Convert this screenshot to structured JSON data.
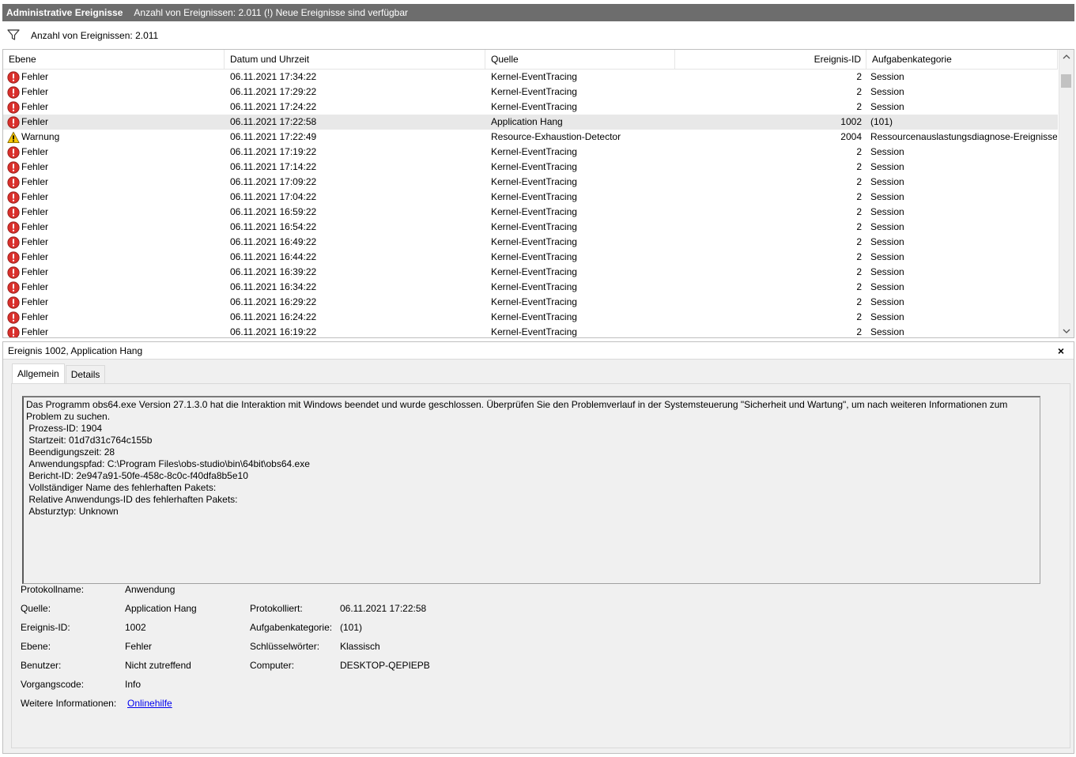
{
  "titlebar": {
    "title": "Administrative Ereignisse",
    "subtitle": "Anzahl von Ereignissen: 2.011 (!) Neue Ereignisse sind verfügbar"
  },
  "filterbar": {
    "icon": "filter-icon",
    "text": "Anzahl von Ereignissen: 2.011"
  },
  "table": {
    "columns": {
      "level": "Ebene",
      "date": "Datum und Uhrzeit",
      "source": "Quelle",
      "id": "Ereignis-ID",
      "category": "Aufgabenkategorie"
    },
    "rows": [
      {
        "level": "Fehler",
        "icon": "error-icon",
        "date": "06.11.2021 17:34:22",
        "source": "Kernel-EventTracing",
        "id": "2",
        "category": "Session"
      },
      {
        "level": "Fehler",
        "icon": "error-icon",
        "date": "06.11.2021 17:29:22",
        "source": "Kernel-EventTracing",
        "id": "2",
        "category": "Session"
      },
      {
        "level": "Fehler",
        "icon": "error-icon",
        "date": "06.11.2021 17:24:22",
        "source": "Kernel-EventTracing",
        "id": "2",
        "category": "Session"
      },
      {
        "level": "Fehler",
        "icon": "error-icon",
        "date": "06.11.2021 17:22:58",
        "source": "Application Hang",
        "id": "1002",
        "category": "(101)",
        "selected": true
      },
      {
        "level": "Warnung",
        "icon": "warning-icon",
        "date": "06.11.2021 17:22:49",
        "source": "Resource-Exhaustion-Detector",
        "id": "2004",
        "category": "Ressourcenauslastungsdiagnose-Ereignisse"
      },
      {
        "level": "Fehler",
        "icon": "error-icon",
        "date": "06.11.2021 17:19:22",
        "source": "Kernel-EventTracing",
        "id": "2",
        "category": "Session"
      },
      {
        "level": "Fehler",
        "icon": "error-icon",
        "date": "06.11.2021 17:14:22",
        "source": "Kernel-EventTracing",
        "id": "2",
        "category": "Session"
      },
      {
        "level": "Fehler",
        "icon": "error-icon",
        "date": "06.11.2021 17:09:22",
        "source": "Kernel-EventTracing",
        "id": "2",
        "category": "Session"
      },
      {
        "level": "Fehler",
        "icon": "error-icon",
        "date": "06.11.2021 17:04:22",
        "source": "Kernel-EventTracing",
        "id": "2",
        "category": "Session"
      },
      {
        "level": "Fehler",
        "icon": "error-icon",
        "date": "06.11.2021 16:59:22",
        "source": "Kernel-EventTracing",
        "id": "2",
        "category": "Session"
      },
      {
        "level": "Fehler",
        "icon": "error-icon",
        "date": "06.11.2021 16:54:22",
        "source": "Kernel-EventTracing",
        "id": "2",
        "category": "Session"
      },
      {
        "level": "Fehler",
        "icon": "error-icon",
        "date": "06.11.2021 16:49:22",
        "source": "Kernel-EventTracing",
        "id": "2",
        "category": "Session"
      },
      {
        "level": "Fehler",
        "icon": "error-icon",
        "date": "06.11.2021 16:44:22",
        "source": "Kernel-EventTracing",
        "id": "2",
        "category": "Session"
      },
      {
        "level": "Fehler",
        "icon": "error-icon",
        "date": "06.11.2021 16:39:22",
        "source": "Kernel-EventTracing",
        "id": "2",
        "category": "Session"
      },
      {
        "level": "Fehler",
        "icon": "error-icon",
        "date": "06.11.2021 16:34:22",
        "source": "Kernel-EventTracing",
        "id": "2",
        "category": "Session"
      },
      {
        "level": "Fehler",
        "icon": "error-icon",
        "date": "06.11.2021 16:29:22",
        "source": "Kernel-EventTracing",
        "id": "2",
        "category": "Session"
      },
      {
        "level": "Fehler",
        "icon": "error-icon",
        "date": "06.11.2021 16:24:22",
        "source": "Kernel-EventTracing",
        "id": "2",
        "category": "Session"
      },
      {
        "level": "Fehler",
        "icon": "error-icon",
        "date": "06.11.2021 16:19:22",
        "source": "Kernel-EventTracing",
        "id": "2",
        "category": "Session"
      }
    ]
  },
  "detail": {
    "header": "Ereignis 1002, Application Hang",
    "close": "×",
    "tabs": [
      "Allgemein",
      "Details"
    ],
    "description": "Das Programm obs64.exe Version 27.1.3.0 hat die Interaktion mit Windows beendet und wurde geschlossen. Überprüfen Sie den Problemverlauf in der Systemsteuerung \"Sicherheit und Wartung\", um nach weiteren Informationen zum Problem zu suchen.\n Prozess-ID: 1904\n Startzeit: 01d7d31c764c155b\n Beendigungszeit: 28\n Anwendungspfad: C:\\Program Files\\obs-studio\\bin\\64bit\\obs64.exe\n Bericht-ID: 2e947a91-50fe-458c-8c0c-f40dfa8b5e10\n Vollständiger Name des fehlerhaften Pakets: \n Relative Anwendungs-ID des fehlerhaften Pakets: \n Absturztyp: Unknown",
    "props": {
      "log_name_label": "Protokollname:",
      "log_name": "Anwendung",
      "source_label": "Quelle:",
      "source": "Application Hang",
      "logged_label": "Protokolliert:",
      "logged": "06.11.2021 17:22:58",
      "event_id_label": "Ereignis-ID:",
      "event_id": "1002",
      "task_label": "Aufgabenkategorie:",
      "task": "(101)",
      "level_label": "Ebene:",
      "level": "Fehler",
      "keywords_label": "Schlüsselwörter:",
      "keywords": "Klassisch",
      "user_label": "Benutzer:",
      "user": "Nicht zutreffend",
      "computer_label": "Computer:",
      "computer": "DESKTOP-QEPIEPB",
      "opcode_label": "Vorgangscode:",
      "opcode": "Info",
      "more_info_label": "Weitere Informationen:",
      "more_info_link": "Onlinehilfe"
    }
  },
  "colors": {
    "titlebar_bg": "#6d6d6d",
    "error_red": "#d9302c",
    "warning_yellow": "#f5c400",
    "selected_row": "#e8e8e8",
    "link": "#0000ee"
  }
}
